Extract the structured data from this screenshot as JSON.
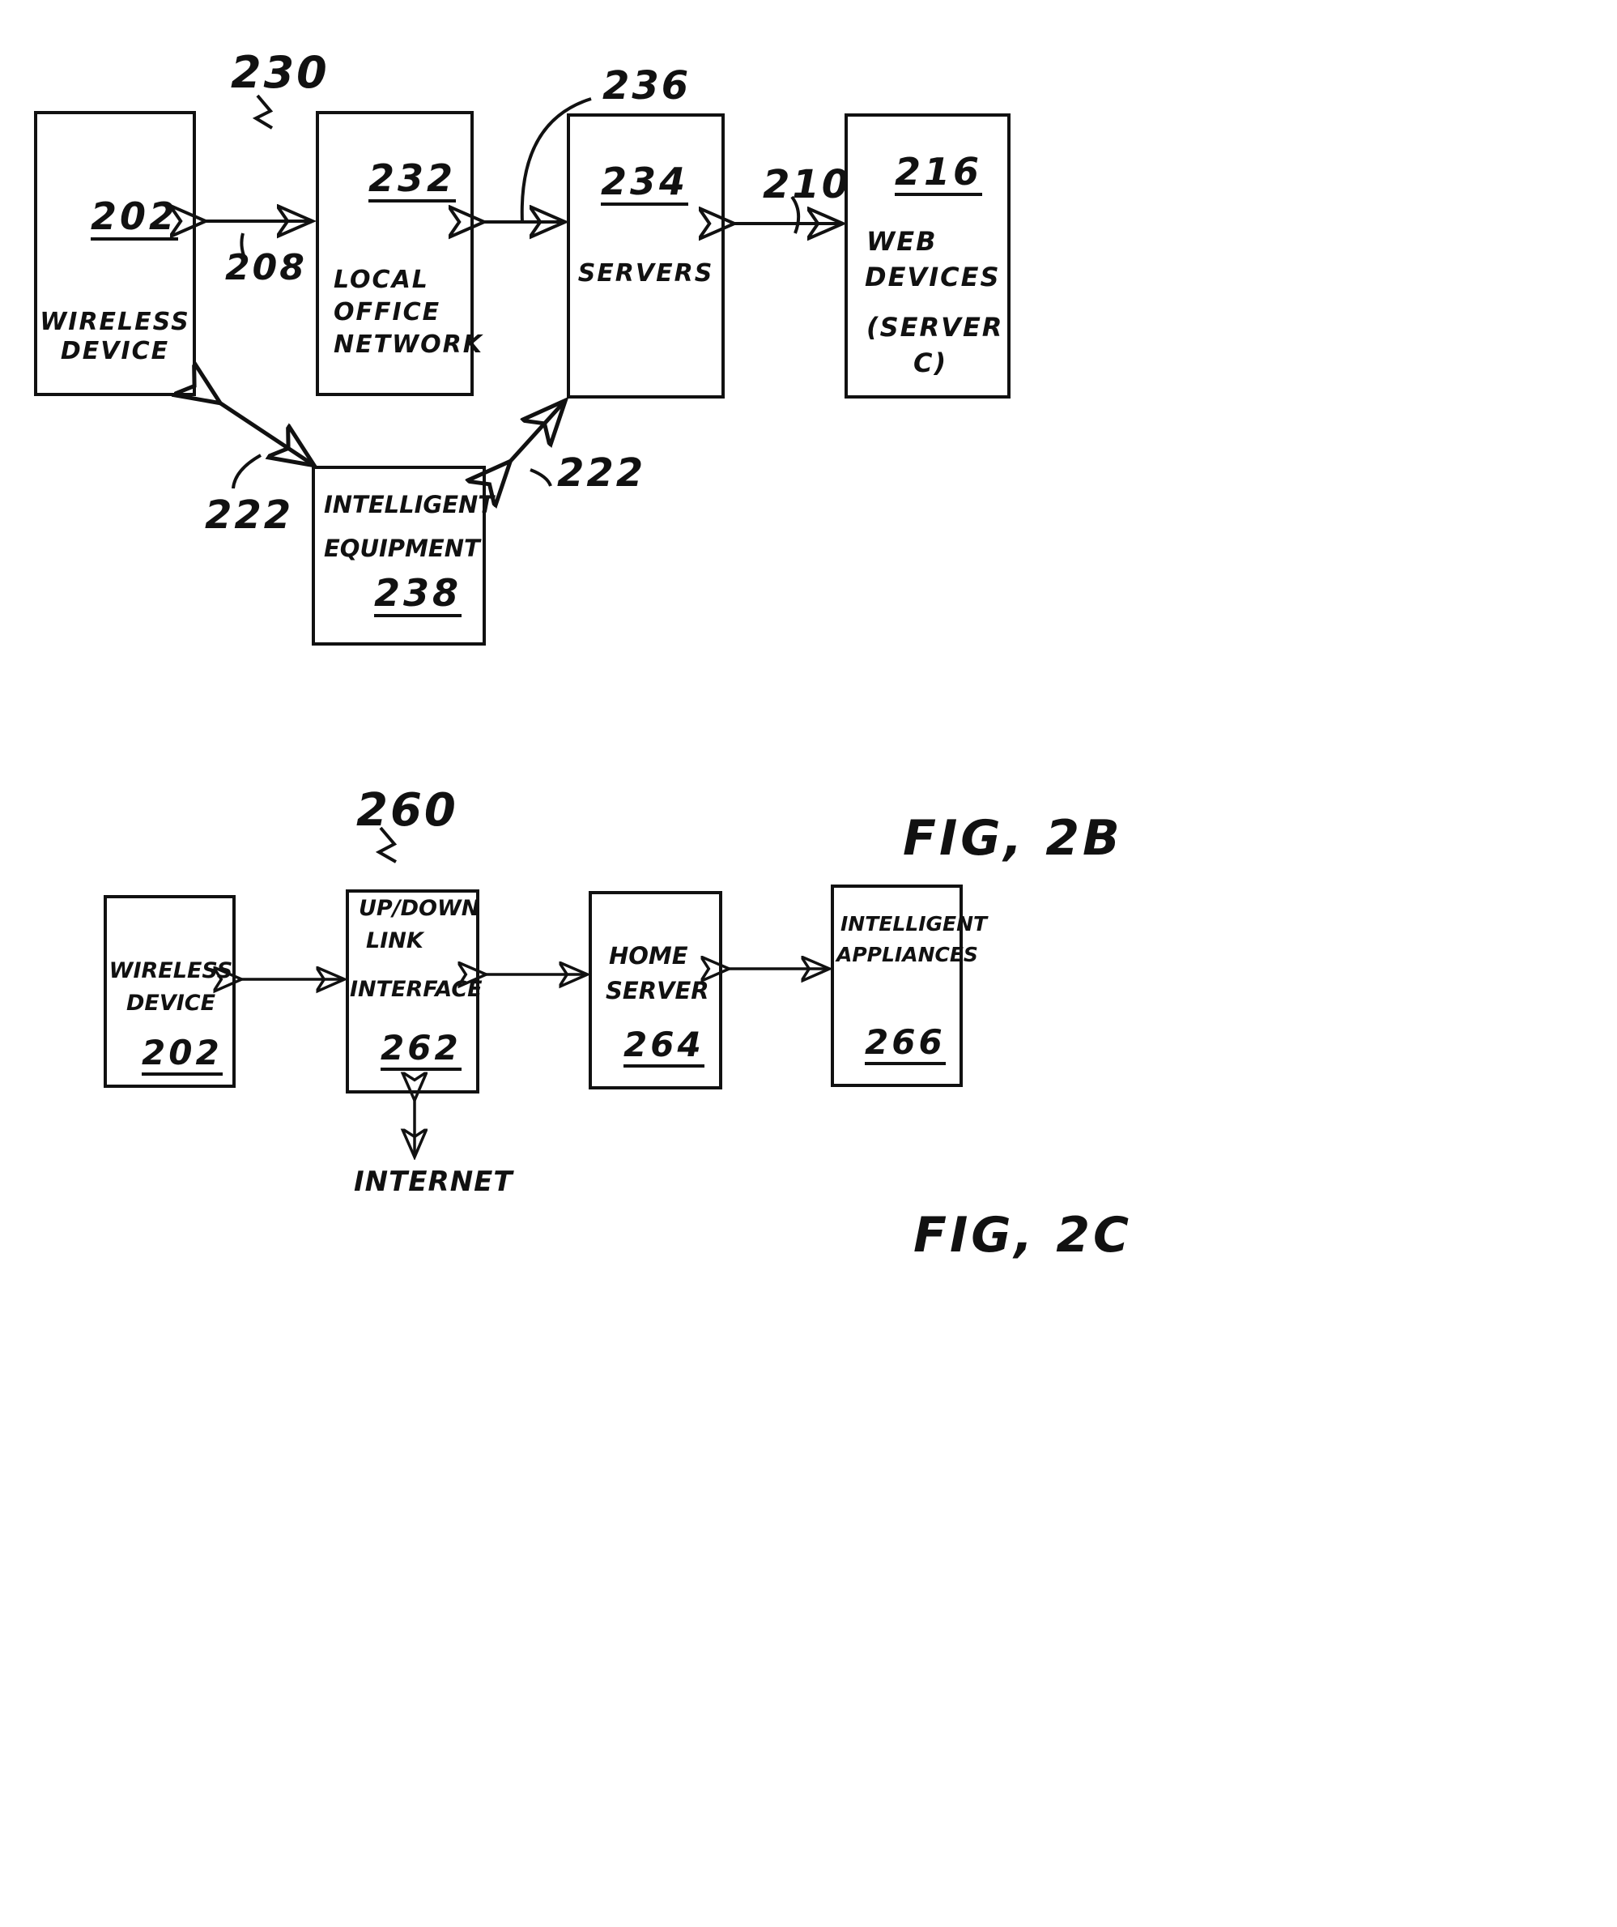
{
  "document": {
    "kind": "patent-drawing-sheet",
    "figures": [
      "FIG, 2B",
      "FIG, 2C"
    ]
  },
  "fig2b": {
    "figure_label": "FIG, 2B",
    "system_ref": "230",
    "boxes": [
      {
        "id": "wireless-device",
        "ref": "202",
        "lines": [
          "WIRELESS",
          "DEVICE"
        ]
      },
      {
        "id": "local-office-network",
        "ref": "232",
        "lines": [
          "LOCAL",
          "OFFICE",
          "NETWORK"
        ]
      },
      {
        "id": "servers",
        "ref": "234",
        "lines": [
          "SERVERS"
        ]
      },
      {
        "id": "web-devices",
        "ref": "216",
        "lines": [
          "WEB",
          "DEVICES",
          "(SERVER",
          "C)"
        ]
      },
      {
        "id": "intelligent-equipment",
        "ref": "238",
        "lines": [
          "INTELLIGENT",
          "EQUIPMENT"
        ]
      }
    ],
    "link_refs": {
      "wireless_to_office": "208",
      "office_to_servers": "236",
      "servers_to_web": "210",
      "wireless_to_equipment": "222",
      "equipment_to_servers": "222"
    }
  },
  "fig2c": {
    "figure_label": "FIG, 2C",
    "system_ref": "260",
    "boxes": [
      {
        "id": "wireless-device",
        "ref": "202",
        "lines": [
          "WIRELESS",
          "DEVICE"
        ]
      },
      {
        "id": "updown-link-interface",
        "ref": "262",
        "lines": [
          "UP/DOWN",
          "LINK",
          "INTERFACE"
        ]
      },
      {
        "id": "home-server",
        "ref": "264",
        "lines": [
          "HOME",
          "SERVER"
        ]
      },
      {
        "id": "intelligent-appliances",
        "ref": "266",
        "lines": [
          "INTELLIGENT",
          "APPLIANCES"
        ]
      }
    ],
    "external_node": "INTERNET"
  },
  "colors": {
    "ink": "#111111",
    "paper": "#ffffff"
  }
}
